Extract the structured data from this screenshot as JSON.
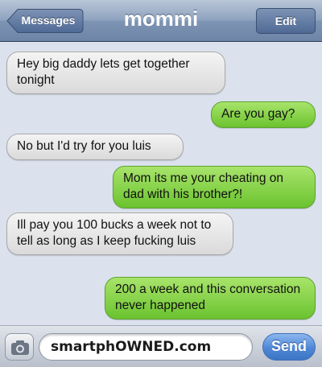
{
  "header": {
    "title": "mommi",
    "back_label": "Messages",
    "edit_label": "Edit"
  },
  "messages": [
    {
      "direction": "incoming",
      "text": "Hey big daddy lets get together tonight"
    },
    {
      "direction": "outgoing",
      "text": "Are you gay?"
    },
    {
      "direction": "incoming",
      "text": "No but I'd try for you luis"
    },
    {
      "direction": "outgoing",
      "text": "Mom its me your cheating on dad with his brother?!"
    },
    {
      "direction": "incoming",
      "text": "Ill pay you 100 bucks a week not to tell as long as I keep fucking luis"
    },
    {
      "direction": "outgoing",
      "text": "200 a week and this conversation never happened"
    }
  ],
  "composer": {
    "input_text": "smartphOWNED.com",
    "send_label": "Send",
    "camera_icon": "camera-icon"
  },
  "colors": {
    "incoming_bubble": "#e8e8e8",
    "outgoing_bubble": "#8fd64f",
    "send_button": "#4f87d6",
    "nav_bar": "#8fa3bf"
  }
}
